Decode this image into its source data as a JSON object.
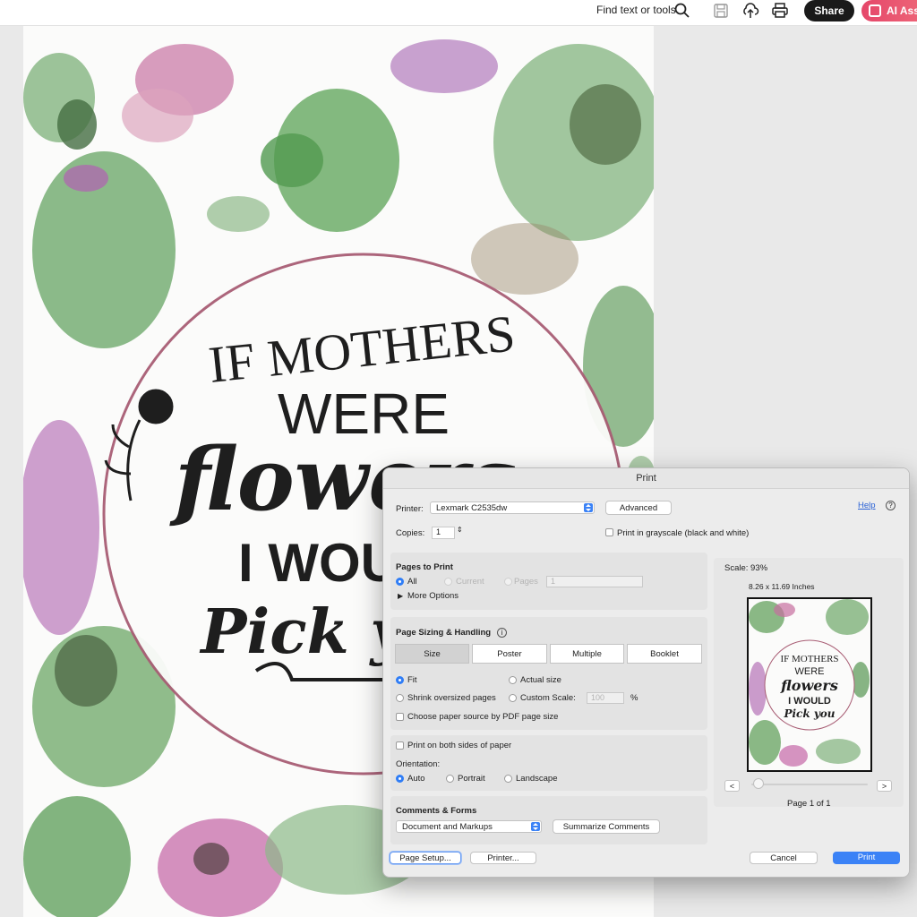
{
  "toolbar": {
    "find_label": "Find text or tools",
    "share_label": "Share",
    "ai_label": "AI Assi",
    "icons": [
      "search-icon",
      "save-icon",
      "upload-icon",
      "print-icon"
    ]
  },
  "poster": {
    "line1": "IF MOTHERS",
    "line2": "WERE",
    "line3": "flowers",
    "line4": "I WOULD",
    "line5": "Pick you"
  },
  "dialog": {
    "title": "Print",
    "printer_label": "Printer:",
    "printer_value": "Lexmark C2535dw",
    "advanced_label": "Advanced",
    "help_label": "Help",
    "copies_label": "Copies:",
    "copies_value": "1",
    "grayscale_label": "Print in grayscale (black and white)",
    "pages_to_print": {
      "title": "Pages to Print",
      "all": "All",
      "current": "Current",
      "pages": "Pages",
      "pages_value": "1",
      "more_options": "More Options"
    },
    "sizing": {
      "title": "Page Sizing & Handling",
      "tabs": [
        "Size",
        "Poster",
        "Multiple",
        "Booklet"
      ],
      "fit": "Fit",
      "actual_size": "Actual size",
      "shrink": "Shrink oversized pages",
      "custom_scale": "Custom Scale:",
      "custom_scale_value": "100",
      "percent": "%",
      "choose_source": "Choose paper source by PDF page size"
    },
    "both_sides": "Print on both sides of paper",
    "orientation": {
      "label": "Orientation:",
      "auto": "Auto",
      "portrait": "Portrait",
      "landscape": "Landscape"
    },
    "comments": {
      "title": "Comments & Forms",
      "value": "Document and Markups",
      "summarize": "Summarize Comments"
    },
    "preview": {
      "scale": "Scale:  93%",
      "size": "8.26 x 11.69 Inches",
      "prev": "<",
      "next": ">",
      "page_info": "Page 1 of 1",
      "mini_lines": [
        "IF MOTHERS",
        "WERE",
        "flowers",
        "I WOULD",
        "Pick you"
      ]
    },
    "buttons": {
      "page_setup": "Page Setup...",
      "printer": "Printer...",
      "cancel": "Cancel",
      "print": "Print"
    }
  }
}
